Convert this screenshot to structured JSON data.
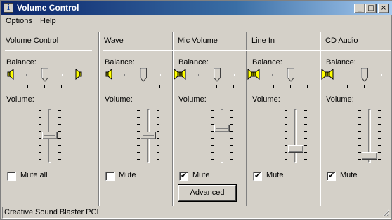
{
  "window": {
    "title": "Volume Control"
  },
  "titlebar_buttons": {
    "minimize": "_",
    "maximize": "□",
    "close": "×"
  },
  "menu": [
    "Options",
    "Help"
  ],
  "labels": {
    "balance": "Balance:",
    "volume": "Volume:",
    "advanced": "Advanced"
  },
  "channels": [
    {
      "title": "Volume Control",
      "mute_label": "Mute all",
      "muted": false,
      "balance": 0.5,
      "volume": 0.5
    },
    {
      "title": "Wave",
      "mute_label": "Mute",
      "muted": false,
      "balance": 0.5,
      "volume": 0.5
    },
    {
      "title": "Mic Volume",
      "mute_label": "Mute",
      "muted": true,
      "balance": 0.5,
      "volume": 0.65
    },
    {
      "title": "Line In",
      "mute_label": "Mute",
      "muted": true,
      "balance": 0.5,
      "volume": 0.2
    },
    {
      "title": "CD Audio",
      "mute_label": "Mute",
      "muted": true,
      "balance": 0.5,
      "volume": 0.05
    }
  ],
  "status": {
    "device": "Creative Sound Blaster PCI"
  },
  "colors": {
    "face": "#d4d0c8",
    "title_start": "#0a246a",
    "title_end": "#a6caf0",
    "speaker": "#ffff00"
  }
}
